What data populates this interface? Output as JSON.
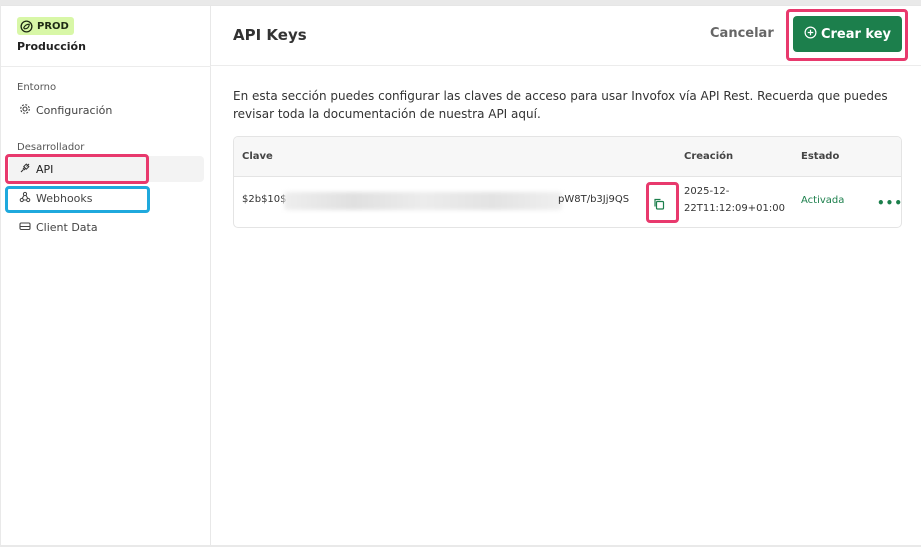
{
  "environment": {
    "badge": "PROD",
    "name": "Producción"
  },
  "sidebar": {
    "sections": [
      {
        "label": "Entorno",
        "items": [
          {
            "label": "Configuración",
            "icon": "gear-icon"
          }
        ]
      },
      {
        "label": "Desarrollador",
        "items": [
          {
            "label": "API",
            "icon": "plug-icon",
            "active": true
          },
          {
            "label": "Webhooks",
            "icon": "webhook-icon"
          },
          {
            "label": "Client Data",
            "icon": "drive-icon"
          }
        ]
      }
    ]
  },
  "header": {
    "title": "API Keys",
    "cancel_label": "Cancelar",
    "create_label": "Crear key"
  },
  "description": "En esta sección puedes configurar las claves de acceso para usar Invofox vía API Rest. Recuerda que puedes revisar toda la documentación de nuestra API aquí.",
  "table": {
    "columns": [
      "Clave",
      "Creación",
      "Estado"
    ],
    "rows": [
      {
        "key_start": "$2b$10$",
        "key_end": "pW8T/b3Jj9QS",
        "created_line1": "2025-12-",
        "created_line2": "22T11:12:09+01:00",
        "status": "Activada",
        "more": "•••"
      }
    ]
  },
  "colors": {
    "accent": "#1c7f4c",
    "badge_bg": "#d8f7a7",
    "highlight_pink": "#e8396d",
    "highlight_blue": "#1fa9dd"
  }
}
